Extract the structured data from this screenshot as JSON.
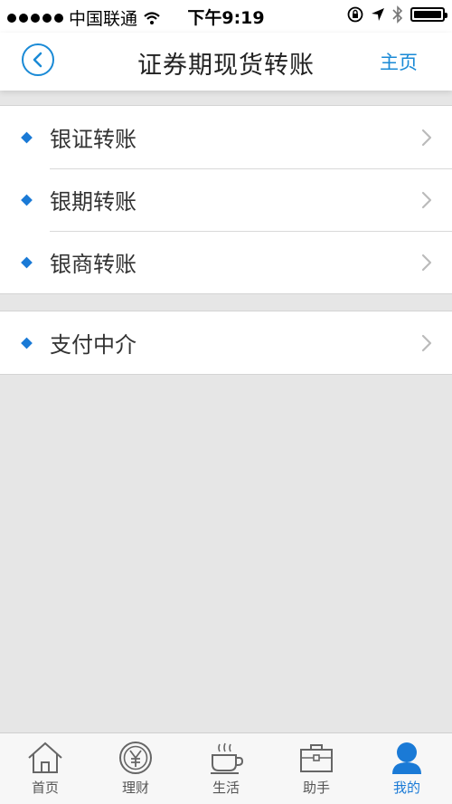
{
  "status_bar": {
    "carrier": "中国联通",
    "time": "下午9:19"
  },
  "nav": {
    "title": "证券期现货转账",
    "home_label": "主页"
  },
  "groups": [
    {
      "items": [
        {
          "label": "银证转账"
        },
        {
          "label": "银期转账"
        },
        {
          "label": "银商转账"
        }
      ]
    },
    {
      "items": [
        {
          "label": "支付中介"
        }
      ]
    }
  ],
  "tabs": [
    {
      "label": "首页",
      "icon": "home-icon"
    },
    {
      "label": "理财",
      "icon": "yen-coin-icon"
    },
    {
      "label": "生活",
      "icon": "coffee-cup-icon"
    },
    {
      "label": "助手",
      "icon": "briefcase-icon"
    },
    {
      "label": "我的",
      "icon": "user-icon",
      "active": true
    }
  ],
  "colors": {
    "accent": "#1a8ad6",
    "background": "#e6e6e6"
  }
}
